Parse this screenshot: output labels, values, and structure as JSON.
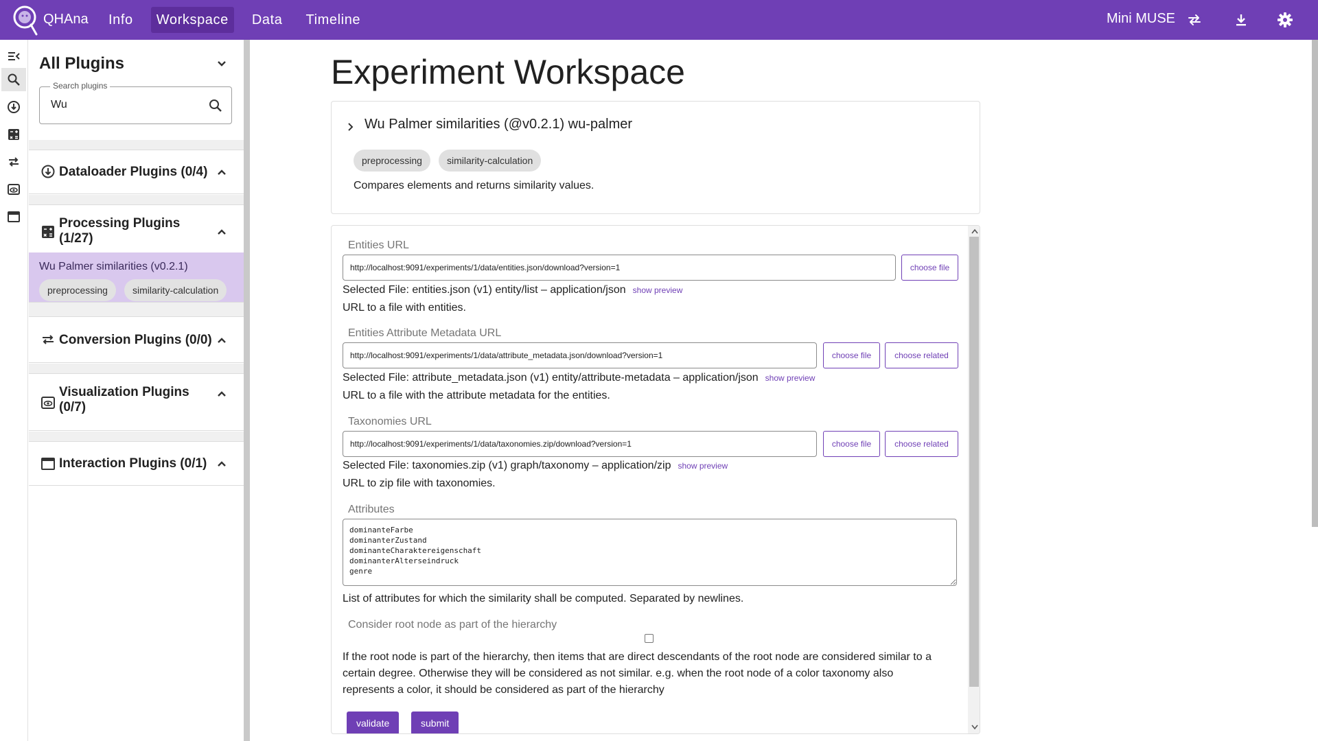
{
  "topbar": {
    "brand": "QHAna",
    "nav": [
      "Info",
      "Workspace",
      "Data",
      "Timeline"
    ],
    "active_nav": "Workspace",
    "backend": "Mini MUSE",
    "accent_color": "#6f3fb5"
  },
  "rail": {
    "icons": [
      "collapse-icon",
      "search-icon",
      "dataloader-icon",
      "processing-icon",
      "conversion-icon",
      "visualization-icon",
      "interaction-icon"
    ]
  },
  "sidebar": {
    "title": "All Plugins",
    "search": {
      "legend": "Search plugins",
      "value": "Wu"
    },
    "sections": {
      "dataloader": "Dataloader Plugins (0/4)",
      "processing": [
        "Processing Plugins",
        "(1/27)"
      ],
      "conversion": "Conversion Plugins (0/0)",
      "visualization": [
        "Visualization Plugins",
        "(0/7)"
      ],
      "interaction": "Interaction Plugins (0/1)"
    },
    "selected_plugin": {
      "title": "Wu Palmer similarities (v0.2.1)",
      "tags": [
        "preprocessing",
        "similarity-calculation"
      ]
    }
  },
  "main": {
    "title": "Experiment Workspace",
    "plugin_card": {
      "title": "Wu Palmer similarities (@v0.2.1) wu-palmer",
      "tags": [
        "preprocessing",
        "similarity-calculation"
      ],
      "description": "Compares elements and returns similarity values."
    },
    "form": {
      "entities": {
        "label": "Entities URL",
        "value": "http://localhost:9091/experiments/1/data/entities.json/download?version=1",
        "choose": "choose file",
        "selected": "Selected File: entities.json (v1) entity/list – application/json",
        "preview": "show preview",
        "help": "URL to a file with entities."
      },
      "metadata": {
        "label": "Entities Attribute Metadata URL",
        "value": "http://localhost:9091/experiments/1/data/attribute_metadata.json/download?version=1",
        "choose": "choose file",
        "related": "choose related",
        "selected": "Selected File: attribute_metadata.json (v1) entity/attribute-metadata – application/json",
        "preview": "show preview",
        "help": "URL to a file with the attribute metadata for the entities."
      },
      "taxonomies": {
        "label": "Taxonomies URL",
        "value": "http://localhost:9091/experiments/1/data/taxonomies.zip/download?version=1",
        "choose": "choose file",
        "related": "choose related",
        "selected": "Selected File: taxonomies.zip (v1) graph/taxonomy – application/zip",
        "preview": "show preview",
        "help": "URL to zip file with taxonomies."
      },
      "attributes": {
        "label": "Attributes",
        "value": "dominanteFarbe\ndominanterZustand\ndominanteCharaktereigenschaft\ndominanterAlterseindruck\ngenre",
        "help": "List of attributes for which the similarity shall be computed. Separated by newlines."
      },
      "root_node": {
        "label": "Consider root node as part of the hierarchy",
        "checked": false,
        "help": "If the root node is part of the hierarchy, then items that are direct descendants of the root node are considered similar to a certain degree. Otherwise they will be considered as not similar. e.g. when the root node of a color taxonomy also represents a color, it should be considered as part of the hierarchy"
      },
      "validate": "validate",
      "submit": "submit"
    }
  }
}
